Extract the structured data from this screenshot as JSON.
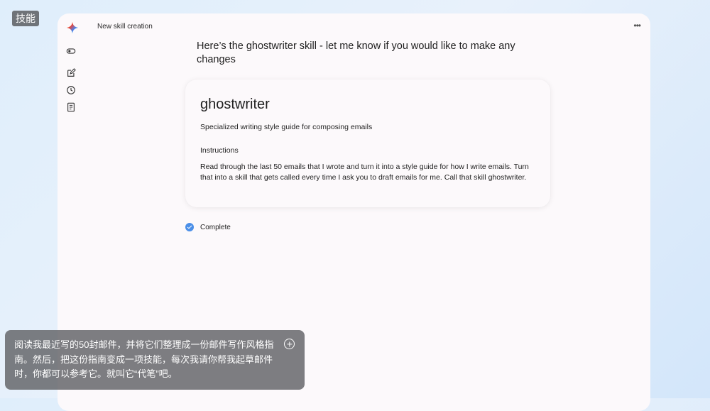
{
  "corner_tag": "技能",
  "window": {
    "title": "New skill creation",
    "more_label": "•••"
  },
  "sidebar": {
    "icons": [
      "toggle-icon",
      "edit-icon",
      "history-icon",
      "document-icon"
    ]
  },
  "main": {
    "heading": "Here’s the ghostwriter skill - let me know if you would like to make any changes",
    "skill": {
      "name": "ghostwriter",
      "description": "Specialized writing style guide for composing emails",
      "instructions_label": "Instructions",
      "instructions": "Read through the last 50 emails that I wrote and turn it into a style guide for how I write emails. Turn that into a skill that gets called every time I ask you to draft emails for me. Call that skill ghostwriter."
    },
    "status": "Complete"
  },
  "prompt": {
    "text": "阅读我最近写的50封邮件，并将它们整理成一份邮件写作风格指南。然后，把这份指南变成一项技能，每次我请你帮我起草邮件时，你都可以参考它。就叫它“代笔”吧。"
  },
  "colors": {
    "accent_blue": "#4b8fe8",
    "background": "#dfeefb",
    "window": "#fcf9fb"
  }
}
